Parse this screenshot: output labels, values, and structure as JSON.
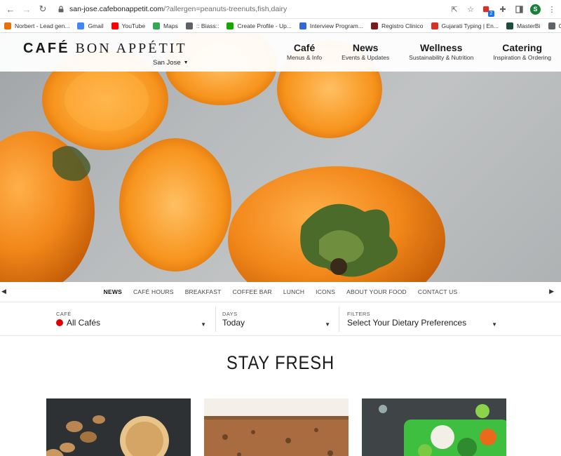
{
  "browser": {
    "url_host": "san-jose.cafebonappetit.com",
    "url_rest": "/?allergen=peanuts-treenuts,fish,dairy",
    "profile_initial": "S",
    "extension_badge": "2"
  },
  "bookmarks": [
    {
      "label": "Norbert - Lead gen...",
      "color": "#e8710a",
      "icon": "norbert-icon"
    },
    {
      "label": "Gmail",
      "color": "#4285f4",
      "icon": "google-icon"
    },
    {
      "label": "YouTube",
      "color": "#ff0000",
      "icon": "youtube-icon"
    },
    {
      "label": "Maps",
      "color": "#34a853",
      "icon": "maps-icon"
    },
    {
      "label": ":: Biass::",
      "color": "#5f6368",
      "icon": "globe-icon"
    },
    {
      "label": "Create Profile - Up...",
      "color": "#14a800",
      "icon": "upwork-icon"
    },
    {
      "label": "Interview Program...",
      "color": "#3367d6",
      "icon": "docs-icon"
    },
    {
      "label": "Registro Clinico",
      "color": "#7a1a1a",
      "icon": "registro-icon"
    },
    {
      "label": "Gujarati Typing | En...",
      "color": "#d93025",
      "icon": "typing-icon"
    },
    {
      "label": "MasterBi",
      "color": "#1f4e3d",
      "icon": "masterbi-icon"
    },
    {
      "label": "Order Refund",
      "color": "#5f6368",
      "icon": "globe-icon"
    }
  ],
  "header": {
    "logo_bold": "CAFÉ",
    "logo_rest": " BON APPÉTIT",
    "location": "San Jose",
    "nav": [
      {
        "title": "Café",
        "subtitle": "Menus & Info"
      },
      {
        "title": "News",
        "subtitle": "Events & Updates"
      },
      {
        "title": "Wellness",
        "subtitle": "Sustainability & Nutrition"
      },
      {
        "title": "Catering",
        "subtitle": "Inspiration & Ordering"
      }
    ]
  },
  "subnav": [
    "NEWS",
    "CAFÉ HOURS",
    "BREAKFAST",
    "COFFEE BAR",
    "LUNCH",
    "ICONS",
    "ABOUT YOUR FOOD",
    "CONTACT US"
  ],
  "filters": {
    "cafe": {
      "label": "CAFÉ",
      "value": "All Cafés"
    },
    "days": {
      "label": "DAYS",
      "value": "Today"
    },
    "filters": {
      "label": "FILTERS",
      "value": "Select Your Dietary Preferences"
    }
  },
  "section_title": "STAY FRESH",
  "colors": {
    "accent_red": "#e10000",
    "persimmon": "#f08a1c"
  }
}
